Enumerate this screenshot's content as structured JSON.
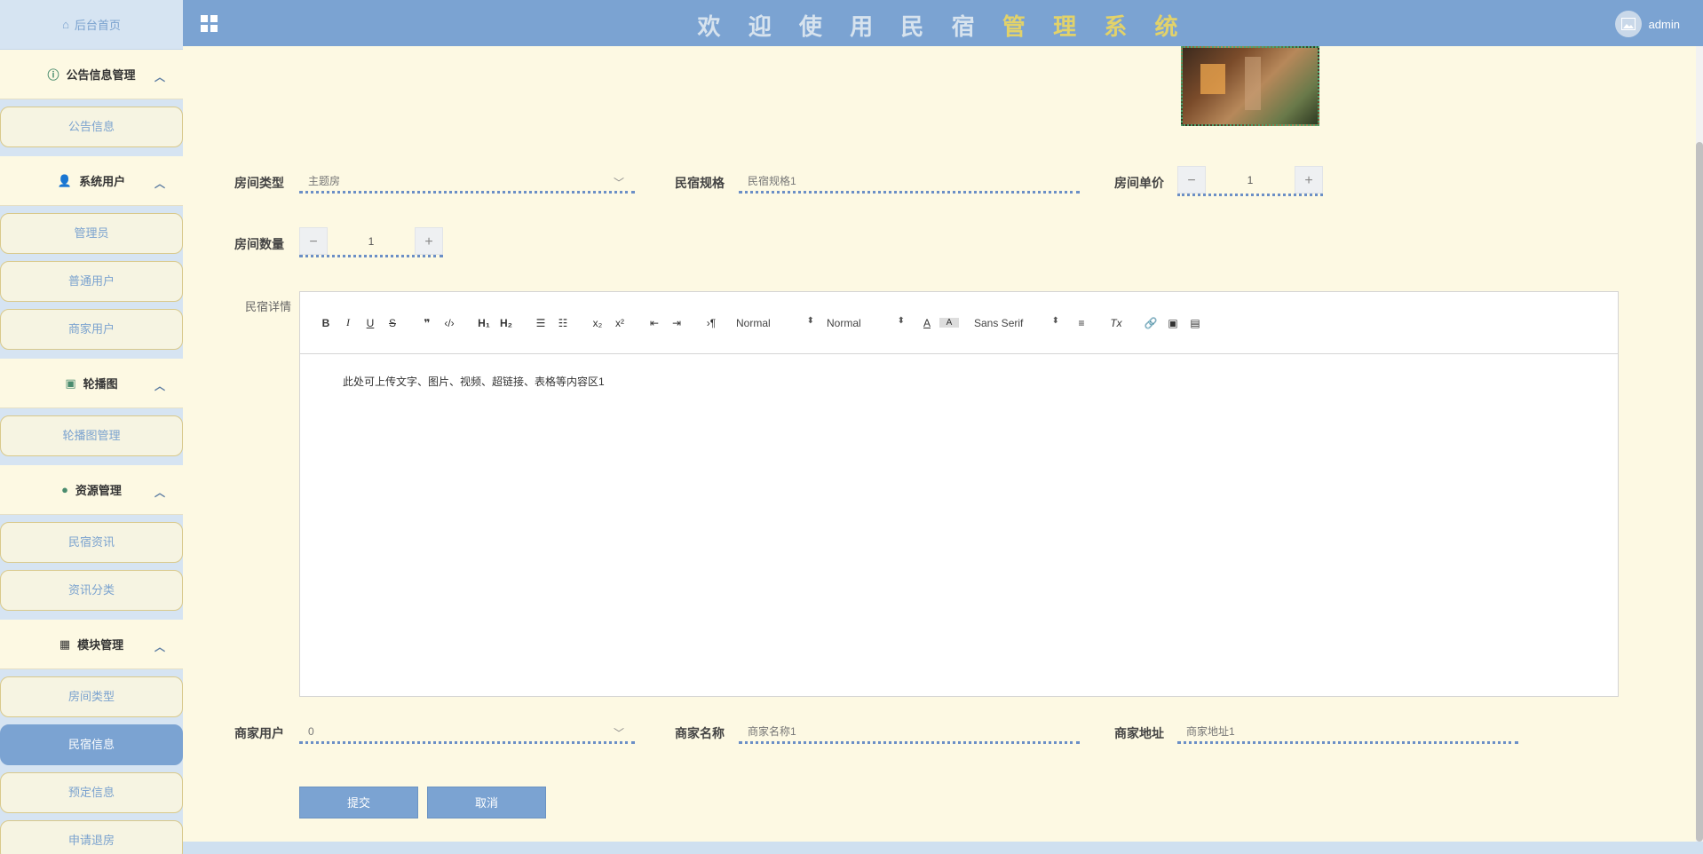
{
  "header": {
    "title_part1": "欢 迎 使 用 民 宿",
    "title_part2": "管 理 系 统",
    "username": "admin"
  },
  "sidebar": {
    "home": "后台首页",
    "groups": [
      {
        "title": "公告信息管理",
        "icon": "info-circle-icon",
        "items": [
          "公告信息"
        ]
      },
      {
        "title": "系统用户",
        "icon": "user-icon",
        "items": [
          "管理员",
          "普通用户",
          "商家用户"
        ]
      },
      {
        "title": "轮播图",
        "icon": "image-icon",
        "items": [
          "轮播图管理"
        ]
      },
      {
        "title": "资源管理",
        "icon": "location-pin-icon",
        "items": [
          "民宿资讯",
          "资讯分类"
        ]
      },
      {
        "title": "模块管理",
        "icon": "grid-icon",
        "items": [
          "房间类型",
          "民宿信息",
          "预定信息",
          "申请退房"
        ]
      }
    ],
    "active_item": "民宿信息"
  },
  "form": {
    "room_type": {
      "label": "房间类型",
      "value": "主题房"
    },
    "spec": {
      "label": "民宿规格",
      "value": "民宿规格1"
    },
    "price": {
      "label": "房间单价",
      "value": "1"
    },
    "quantity": {
      "label": "房间数量",
      "value": "1"
    },
    "detail": {
      "label": "民宿详情",
      "content": "此处可上传文字、图片、视频、超链接、表格等内容区1",
      "toolbar": {
        "header_select": "Normal",
        "size_select": "Normal",
        "font_select": "Sans Serif"
      }
    },
    "merchant_user": {
      "label": "商家用户",
      "value": "0"
    },
    "merchant_name": {
      "label": "商家名称",
      "value": "商家名称1"
    },
    "merchant_address": {
      "label": "商家地址",
      "value": "商家地址1"
    },
    "submit": "提交",
    "cancel": "取消"
  }
}
